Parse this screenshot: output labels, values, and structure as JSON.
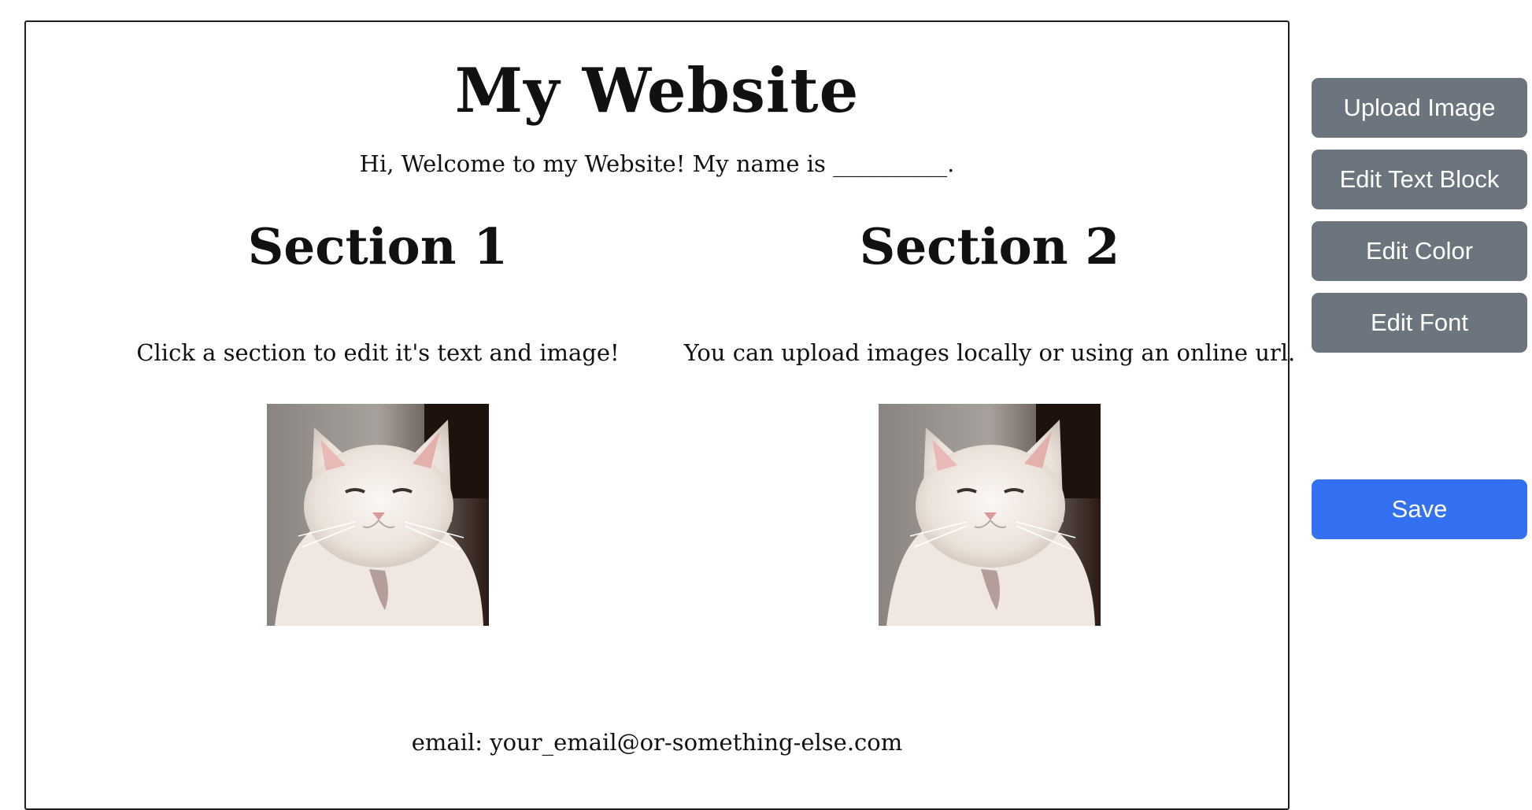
{
  "website": {
    "title": "My Website",
    "intro": "Hi, Welcome to my Website! My name is __________.",
    "sections": [
      {
        "heading": "Section 1",
        "text": "Click a section to edit it's text and image!",
        "image": "cat-photo"
      },
      {
        "heading": "Section 2",
        "text": "You can upload images locally or using an online url.",
        "image": "cat-photo"
      }
    ],
    "footer_email": "email: your_email@or-something-else.com"
  },
  "toolbar": {
    "upload_image": "Upload Image",
    "edit_text_block": "Edit Text Block",
    "edit_color": "Edit Color",
    "edit_font": "Edit Font",
    "save": "Save"
  },
  "colors": {
    "toolbar_button": "#6c757d",
    "save_button": "#3371f2",
    "canvas_border": "#1f1f1f"
  }
}
